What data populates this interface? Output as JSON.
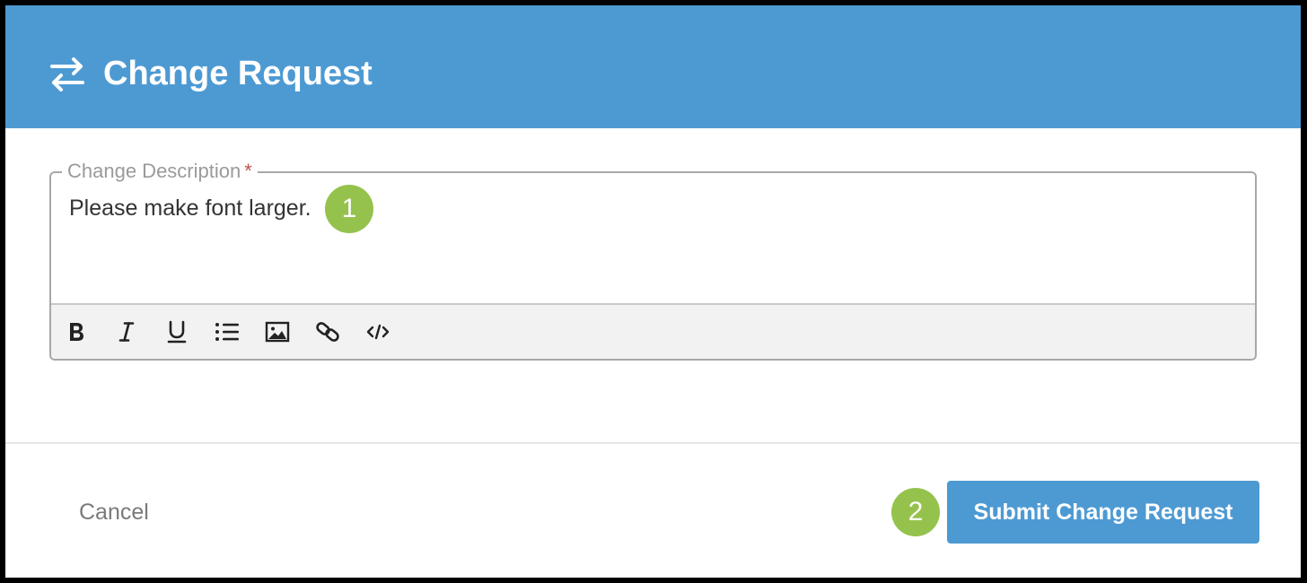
{
  "dialog": {
    "title": "Change Request",
    "title_icon": "swap-arrows-icon",
    "header_color": "#4d9ad3"
  },
  "description_field": {
    "label": "Change Description",
    "required_marker": "*",
    "value": "Please make font larger."
  },
  "toolbar": {
    "buttons": [
      "bold-icon",
      "italic-icon",
      "underline-icon",
      "bulleted-list-icon",
      "image-icon",
      "link-icon",
      "code-icon"
    ]
  },
  "annotations": {
    "step1": "1",
    "step2": "2",
    "color": "#95c24d"
  },
  "footer": {
    "cancel_label": "Cancel",
    "submit_label": "Submit Change Request"
  }
}
